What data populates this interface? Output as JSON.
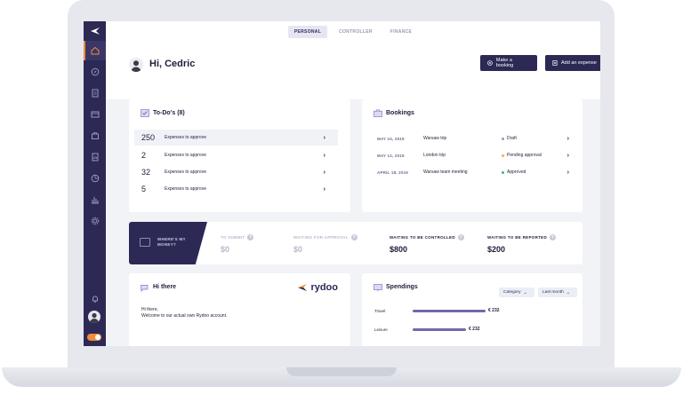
{
  "tabs": [
    "PERSONAL",
    "CONTROLLER",
    "FINANCE"
  ],
  "header": {
    "greeting": "Hi, Cedric",
    "make_booking": "Make a booking",
    "add_expense": "Add an expense"
  },
  "todos": {
    "title": "To-Do's (8)",
    "items": [
      {
        "count": "250",
        "label": "Expenses to approve"
      },
      {
        "count": "2",
        "label": "Expenses to approve"
      },
      {
        "count": "32",
        "label": "Expenses to approve"
      },
      {
        "count": "5",
        "label": "Expenses to approve"
      }
    ]
  },
  "bookings": {
    "title": "Bookings",
    "items": [
      {
        "date": "MAY 24, 2019",
        "name": "Warsaw trip",
        "status": "Draft",
        "status_color": "#9a98b5"
      },
      {
        "date": "MAY 12, 2019",
        "name": "London trip",
        "status": "Pending approval",
        "status_color": "#f2b431"
      },
      {
        "date": "APRIL 18, 2019",
        "name": "Warsaw team meeting",
        "status": "Approved",
        "status_color": "#2fbf71"
      }
    ]
  },
  "money": {
    "badge_line1": "WHERE'S MY",
    "badge_line2": "MONEY?",
    "stats": [
      {
        "label": "TO SUBMIT",
        "value": "$0",
        "muted": true
      },
      {
        "label": "WAITING FOR APPROVAL",
        "value": "$0",
        "muted": true
      },
      {
        "label": "WAITING TO BE CONTROLLED",
        "value": "$800",
        "muted": false
      },
      {
        "label": "WAITING TO BE REPORTED",
        "value": "$200",
        "muted": false
      }
    ]
  },
  "hi_there": {
    "title": "Hi there",
    "brand": "rydoo",
    "line1": "Hi there,",
    "line2": "Welcome to our actual own Rydoo account."
  },
  "spendings": {
    "title": "Spendings",
    "filter1": "Category",
    "filter2": "Last month",
    "items": [
      {
        "label": "Travel",
        "value": "€ 232",
        "fraction": 1.0
      },
      {
        "label": "Leisure",
        "value": "€ 232",
        "fraction": 0.73
      }
    ]
  },
  "colors": {
    "primary": "#2c2955",
    "accent": "#f08c3c"
  }
}
